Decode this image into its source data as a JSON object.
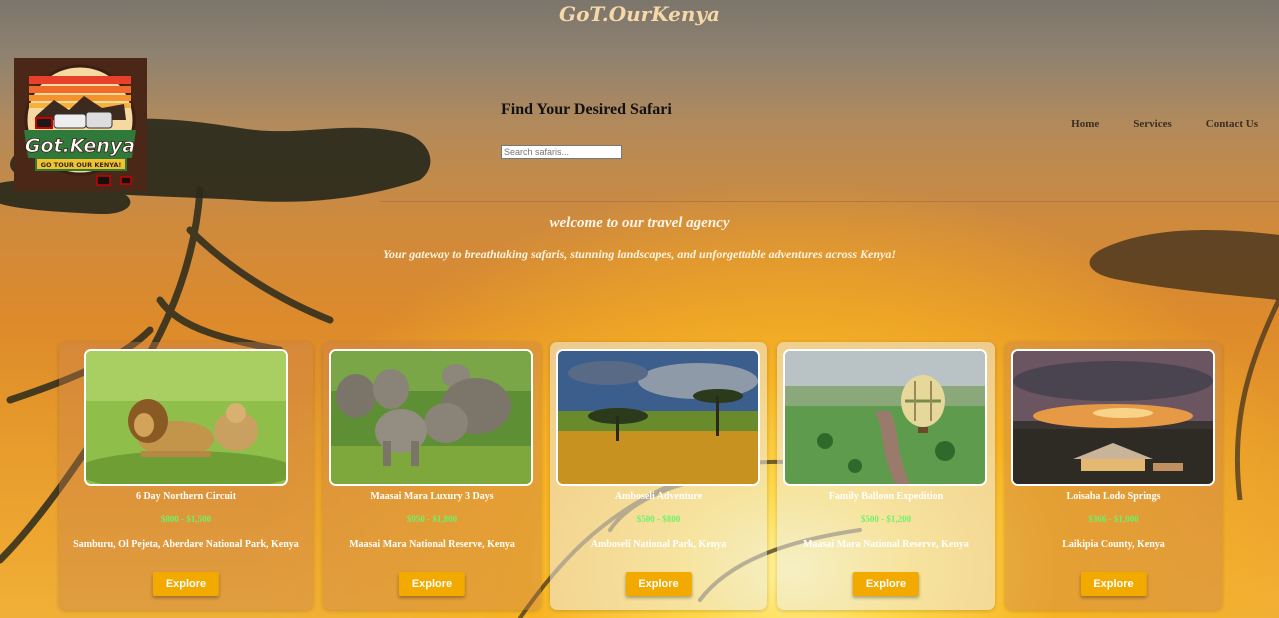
{
  "site_title": "GoT.OurKenya",
  "logo": {
    "main_text": "Got.Kenya",
    "ribbon_text": "GO TOUR OUR KENYA!"
  },
  "search": {
    "heading": "Find Your Desired Safari",
    "placeholder": "Search safaris..."
  },
  "nav": {
    "items": [
      "Home",
      "Services",
      "Contact Us"
    ]
  },
  "hero": {
    "welcome": "welcome to our travel agency",
    "tagline": "Your gateway to breathtaking safaris, stunning landscapes, and unforgettable adventures across Kenya!"
  },
  "cards": [
    {
      "name": "6 Day Northern Circuit",
      "price": "$800 - $1,500",
      "location": "Samburu, Ol Pejeta, Aberdare National Park, Kenya",
      "button": "Explore",
      "image_subject": "lions"
    },
    {
      "name": "Maasai Mara Luxury 3 Days",
      "price": "$950 - $1,800",
      "location": "Maasai Mara National Reserve, Kenya",
      "button": "Explore",
      "image_subject": "elephants"
    },
    {
      "name": "Amboseli Adventure",
      "price": "$500 - $800",
      "location": "Amboseli National Park, Kenya",
      "button": "Explore",
      "image_subject": "savanna-trees"
    },
    {
      "name": "Family Balloon Expedition",
      "price": "$500 - $1,200",
      "location": "Maasai Mara National Reserve, Kenya",
      "button": "Explore",
      "image_subject": "hot-air-balloon"
    },
    {
      "name": "Loisaba Lodo Springs",
      "price": "$366 - $1,000",
      "location": "Laikipia County, Kenya",
      "button": "Explore",
      "image_subject": "lodge-sunset"
    }
  ],
  "colors": {
    "accent_button": "#f2a900",
    "price_text": "#6ff26a",
    "title_text": "#f6d9a8"
  }
}
